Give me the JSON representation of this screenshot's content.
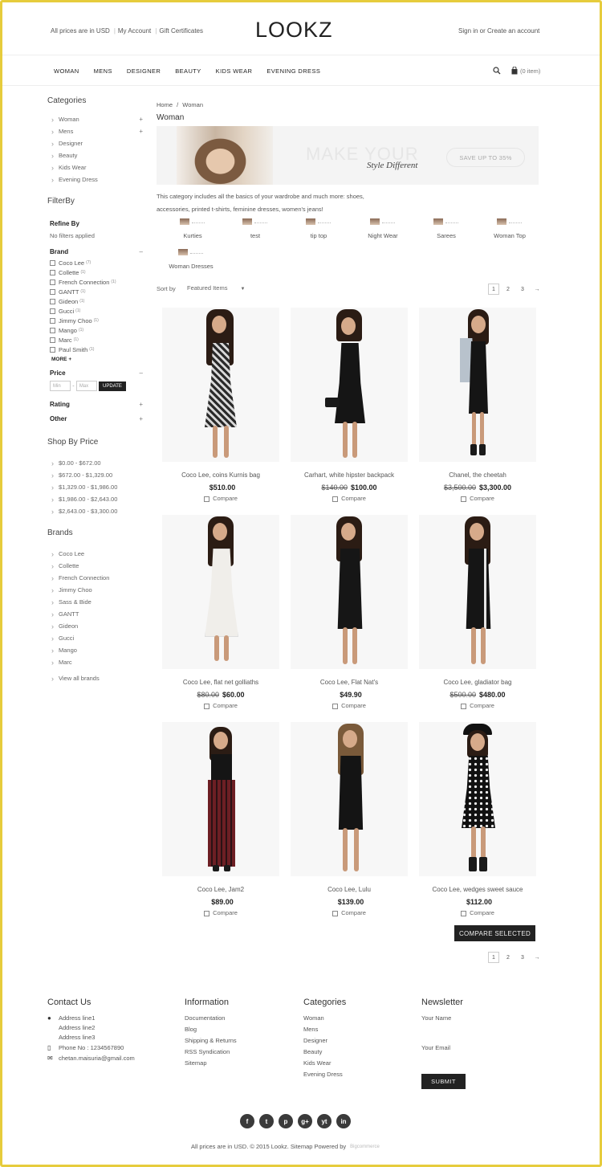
{
  "header": {
    "currency": "All prices are in USD",
    "my_account": "My Account",
    "gift": "Gift Certificates",
    "logo": "LOOKZ",
    "signin": "Sign in or Create an account",
    "nav": [
      "WOMAN",
      "MENS",
      "DESIGNER",
      "BEAUTY",
      "KIDS WEAR",
      "EVENING DRESS"
    ],
    "cart": "(0 item)"
  },
  "sidebar": {
    "categories_title": "Categories",
    "categories": [
      "Woman",
      "Mens",
      "Designer",
      "Beauty",
      "Kids Wear",
      "Evening Dress"
    ],
    "filterby_title": "FilterBy",
    "refine_by": "Refine By",
    "no_filters": "No filters applied",
    "brand_title": "Brand",
    "brand_filters": [
      {
        "name": "Coco Lee",
        "count": "(7)"
      },
      {
        "name": "Collette",
        "count": "(1)"
      },
      {
        "name": "French Connection",
        "count": "(1)"
      },
      {
        "name": "GANTT",
        "count": "(1)"
      },
      {
        "name": "Gideon",
        "count": "(1)"
      },
      {
        "name": "Gucci",
        "count": "(1)"
      },
      {
        "name": "Jimmy Choo",
        "count": "(1)"
      },
      {
        "name": "Mango",
        "count": "(1)"
      },
      {
        "name": "Marc",
        "count": "(1)"
      },
      {
        "name": "Paul Smith",
        "count": "(1)"
      }
    ],
    "more": "MORE",
    "price_title": "Price",
    "min_placeholder": "Min",
    "max_placeholder": "Max",
    "update": "UPDATE",
    "rating": "Rating",
    "other": "Other",
    "shop_by_price_title": "Shop By Price",
    "price_ranges": [
      "$0.00 - $672.00",
      "$672.00 - $1,329.00",
      "$1,329.00 - $1,986.00",
      "$1,986.00 - $2,643.00",
      "$2,643.00 - $3,300.00"
    ],
    "brands_title": "Brands",
    "brands": [
      "Coco Lee",
      "Collette",
      "French Connection",
      "Jimmy Choo",
      "Sass & Bide",
      "GANTT",
      "Gideon",
      "Gucci",
      "Mango",
      "Marc"
    ],
    "view_all": "View all brands"
  },
  "main": {
    "breadcrumb_home": "Home",
    "breadcrumb_sep": "/",
    "breadcrumb_current": "Woman",
    "title": "Woman",
    "banner_headline": "MAKE YOUR",
    "banner_sub": "Style Different",
    "banner_button": "SAVE UP TO 35%",
    "description": "This category includes all the basics of your wardrobe and much more: shoes, accessories, printed t-shirts, feminine dresses, women's jeans!",
    "subcategories": [
      "Kurties",
      "test",
      "tip top",
      "Night Wear",
      "Sarees",
      "Woman Top",
      "Woman Dresses"
    ],
    "sort_label": "Sort by",
    "sort_value": "Featured Items",
    "pages": [
      "1",
      "2",
      "3",
      "→"
    ],
    "compare_label": "Compare",
    "compare_selected": "COMPARE SELECTED",
    "products": [
      {
        "name": "Coco Lee, coins Kurnis bag",
        "old": "",
        "price": "$510.00"
      },
      {
        "name": "Carhart, white hipster backpack",
        "old": "$140.00",
        "price": "$100.00"
      },
      {
        "name": "Chanel, the cheetah",
        "old": "$3,500.00",
        "price": "$3,300.00"
      },
      {
        "name": "Coco Lee, flat net golliaths",
        "old": "$80.00",
        "price": "$60.00"
      },
      {
        "name": "Coco Lee, Flat Nat's",
        "old": "",
        "price": "$49.90"
      },
      {
        "name": "Coco Lee, gladiator bag",
        "old": "$500.00",
        "price": "$480.00"
      },
      {
        "name": "Coco Lee, Jam2",
        "old": "",
        "price": "$89.00"
      },
      {
        "name": "Coco Lee, Lulu",
        "old": "",
        "price": "$139.00"
      },
      {
        "name": "Coco Lee, wedges sweet sauce",
        "old": "",
        "price": "$112.00"
      }
    ]
  },
  "footer": {
    "contact_title": "Contact Us",
    "address": [
      "Address line1",
      "Address line2",
      "Address line3"
    ],
    "phone": "Phone No : 1234567890",
    "email": "chetan.maisuria@gmail.com",
    "info_title": "Information",
    "info_links": [
      "Documentation",
      "Blog",
      "Shipping & Returns",
      "RSS Syndication",
      "Sitemap"
    ],
    "cat_title": "Categories",
    "cat_links": [
      "Woman",
      "Mens",
      "Designer",
      "Beauty",
      "Kids Wear",
      "Evening Dress"
    ],
    "news_title": "Newsletter",
    "your_name": "Your Name",
    "your_email": "Your Email",
    "submit": "SUBMIT",
    "social": [
      "f",
      "t",
      "p",
      "g+",
      "yt",
      "in"
    ],
    "copyright": "All prices are in USD. © 2015 Lookz. Sitemap Powered by",
    "powered": "Bigcommerce"
  }
}
